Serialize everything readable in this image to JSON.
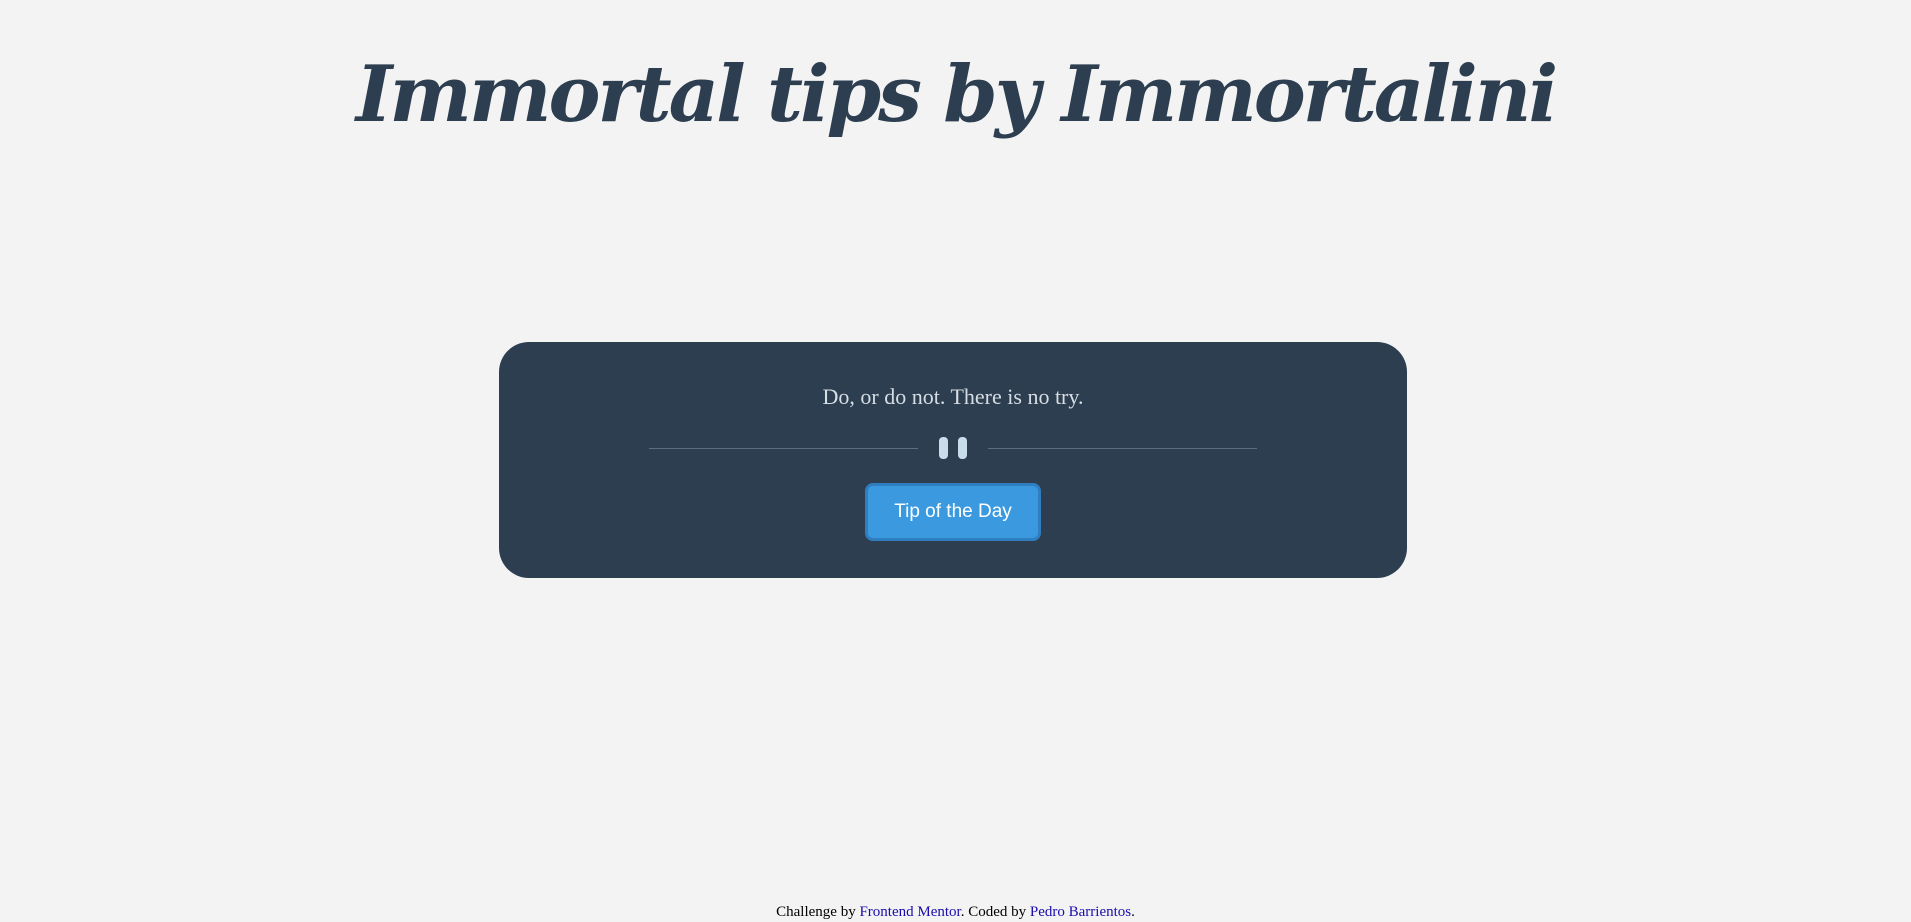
{
  "header": {
    "title": "Immortal tips by Immortalini"
  },
  "card": {
    "tip": "Do, or do not. There is no try.",
    "divider_icon": "pause-icon",
    "button_label": "Tip of the Day"
  },
  "footer": {
    "challenge_prefix": "Challenge by",
    "challenge_link": "Frontend Mentor",
    "coded_prefix": ". Coded by",
    "coded_link": "Pedro Barrientos",
    "suffix": "."
  },
  "colors": {
    "background": "#f3f3f3",
    "card": "#2d3e50",
    "title": "#2d3e50",
    "button": "#3b99e0",
    "button_border": "#2f7fc0",
    "icon": "#c9dcec",
    "link": "#1a0dab"
  }
}
